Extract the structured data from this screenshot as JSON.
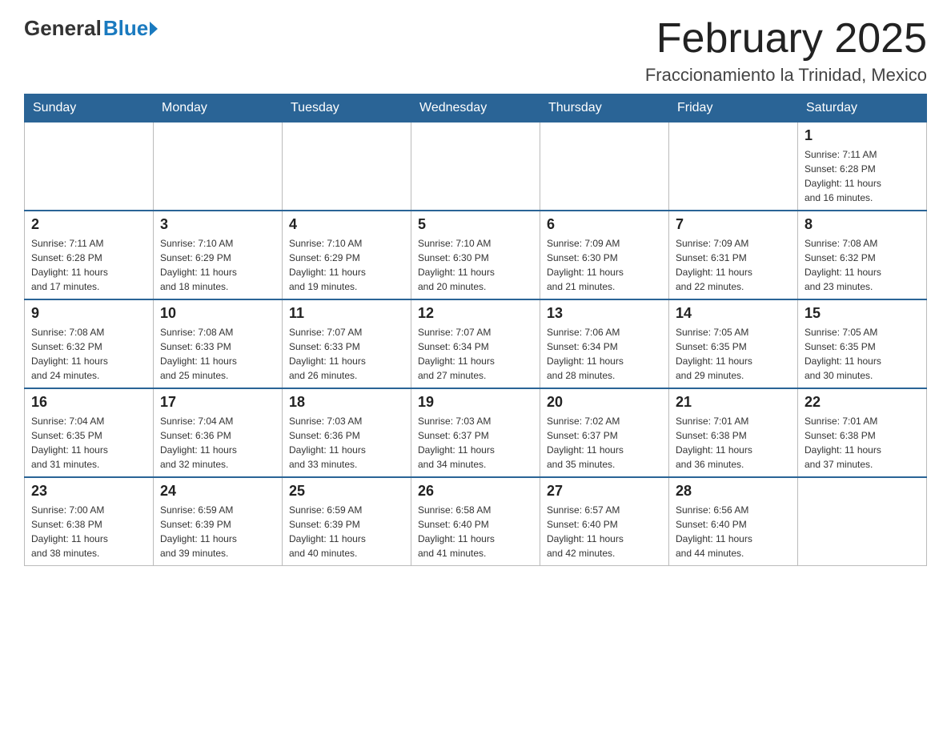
{
  "header": {
    "logo": {
      "general": "General",
      "blue": "Blue",
      "triangle_color": "#1a7abf"
    },
    "title": "February 2025",
    "subtitle": "Fraccionamiento la Trinidad, Mexico"
  },
  "calendar": {
    "days_of_week": [
      "Sunday",
      "Monday",
      "Tuesday",
      "Wednesday",
      "Thursday",
      "Friday",
      "Saturday"
    ],
    "weeks": [
      {
        "days": [
          {
            "number": "",
            "info": ""
          },
          {
            "number": "",
            "info": ""
          },
          {
            "number": "",
            "info": ""
          },
          {
            "number": "",
            "info": ""
          },
          {
            "number": "",
            "info": ""
          },
          {
            "number": "",
            "info": ""
          },
          {
            "number": "1",
            "info": "Sunrise: 7:11 AM\nSunset: 6:28 PM\nDaylight: 11 hours\nand 16 minutes."
          }
        ]
      },
      {
        "days": [
          {
            "number": "2",
            "info": "Sunrise: 7:11 AM\nSunset: 6:28 PM\nDaylight: 11 hours\nand 17 minutes."
          },
          {
            "number": "3",
            "info": "Sunrise: 7:10 AM\nSunset: 6:29 PM\nDaylight: 11 hours\nand 18 minutes."
          },
          {
            "number": "4",
            "info": "Sunrise: 7:10 AM\nSunset: 6:29 PM\nDaylight: 11 hours\nand 19 minutes."
          },
          {
            "number": "5",
            "info": "Sunrise: 7:10 AM\nSunset: 6:30 PM\nDaylight: 11 hours\nand 20 minutes."
          },
          {
            "number": "6",
            "info": "Sunrise: 7:09 AM\nSunset: 6:30 PM\nDaylight: 11 hours\nand 21 minutes."
          },
          {
            "number": "7",
            "info": "Sunrise: 7:09 AM\nSunset: 6:31 PM\nDaylight: 11 hours\nand 22 minutes."
          },
          {
            "number": "8",
            "info": "Sunrise: 7:08 AM\nSunset: 6:32 PM\nDaylight: 11 hours\nand 23 minutes."
          }
        ]
      },
      {
        "days": [
          {
            "number": "9",
            "info": "Sunrise: 7:08 AM\nSunset: 6:32 PM\nDaylight: 11 hours\nand 24 minutes."
          },
          {
            "number": "10",
            "info": "Sunrise: 7:08 AM\nSunset: 6:33 PM\nDaylight: 11 hours\nand 25 minutes."
          },
          {
            "number": "11",
            "info": "Sunrise: 7:07 AM\nSunset: 6:33 PM\nDaylight: 11 hours\nand 26 minutes."
          },
          {
            "number": "12",
            "info": "Sunrise: 7:07 AM\nSunset: 6:34 PM\nDaylight: 11 hours\nand 27 minutes."
          },
          {
            "number": "13",
            "info": "Sunrise: 7:06 AM\nSunset: 6:34 PM\nDaylight: 11 hours\nand 28 minutes."
          },
          {
            "number": "14",
            "info": "Sunrise: 7:05 AM\nSunset: 6:35 PM\nDaylight: 11 hours\nand 29 minutes."
          },
          {
            "number": "15",
            "info": "Sunrise: 7:05 AM\nSunset: 6:35 PM\nDaylight: 11 hours\nand 30 minutes."
          }
        ]
      },
      {
        "days": [
          {
            "number": "16",
            "info": "Sunrise: 7:04 AM\nSunset: 6:35 PM\nDaylight: 11 hours\nand 31 minutes."
          },
          {
            "number": "17",
            "info": "Sunrise: 7:04 AM\nSunset: 6:36 PM\nDaylight: 11 hours\nand 32 minutes."
          },
          {
            "number": "18",
            "info": "Sunrise: 7:03 AM\nSunset: 6:36 PM\nDaylight: 11 hours\nand 33 minutes."
          },
          {
            "number": "19",
            "info": "Sunrise: 7:03 AM\nSunset: 6:37 PM\nDaylight: 11 hours\nand 34 minutes."
          },
          {
            "number": "20",
            "info": "Sunrise: 7:02 AM\nSunset: 6:37 PM\nDaylight: 11 hours\nand 35 minutes."
          },
          {
            "number": "21",
            "info": "Sunrise: 7:01 AM\nSunset: 6:38 PM\nDaylight: 11 hours\nand 36 minutes."
          },
          {
            "number": "22",
            "info": "Sunrise: 7:01 AM\nSunset: 6:38 PM\nDaylight: 11 hours\nand 37 minutes."
          }
        ]
      },
      {
        "days": [
          {
            "number": "23",
            "info": "Sunrise: 7:00 AM\nSunset: 6:38 PM\nDaylight: 11 hours\nand 38 minutes."
          },
          {
            "number": "24",
            "info": "Sunrise: 6:59 AM\nSunset: 6:39 PM\nDaylight: 11 hours\nand 39 minutes."
          },
          {
            "number": "25",
            "info": "Sunrise: 6:59 AM\nSunset: 6:39 PM\nDaylight: 11 hours\nand 40 minutes."
          },
          {
            "number": "26",
            "info": "Sunrise: 6:58 AM\nSunset: 6:40 PM\nDaylight: 11 hours\nand 41 minutes."
          },
          {
            "number": "27",
            "info": "Sunrise: 6:57 AM\nSunset: 6:40 PM\nDaylight: 11 hours\nand 42 minutes."
          },
          {
            "number": "28",
            "info": "Sunrise: 6:56 AM\nSunset: 6:40 PM\nDaylight: 11 hours\nand 44 minutes."
          },
          {
            "number": "",
            "info": ""
          }
        ]
      }
    ]
  }
}
